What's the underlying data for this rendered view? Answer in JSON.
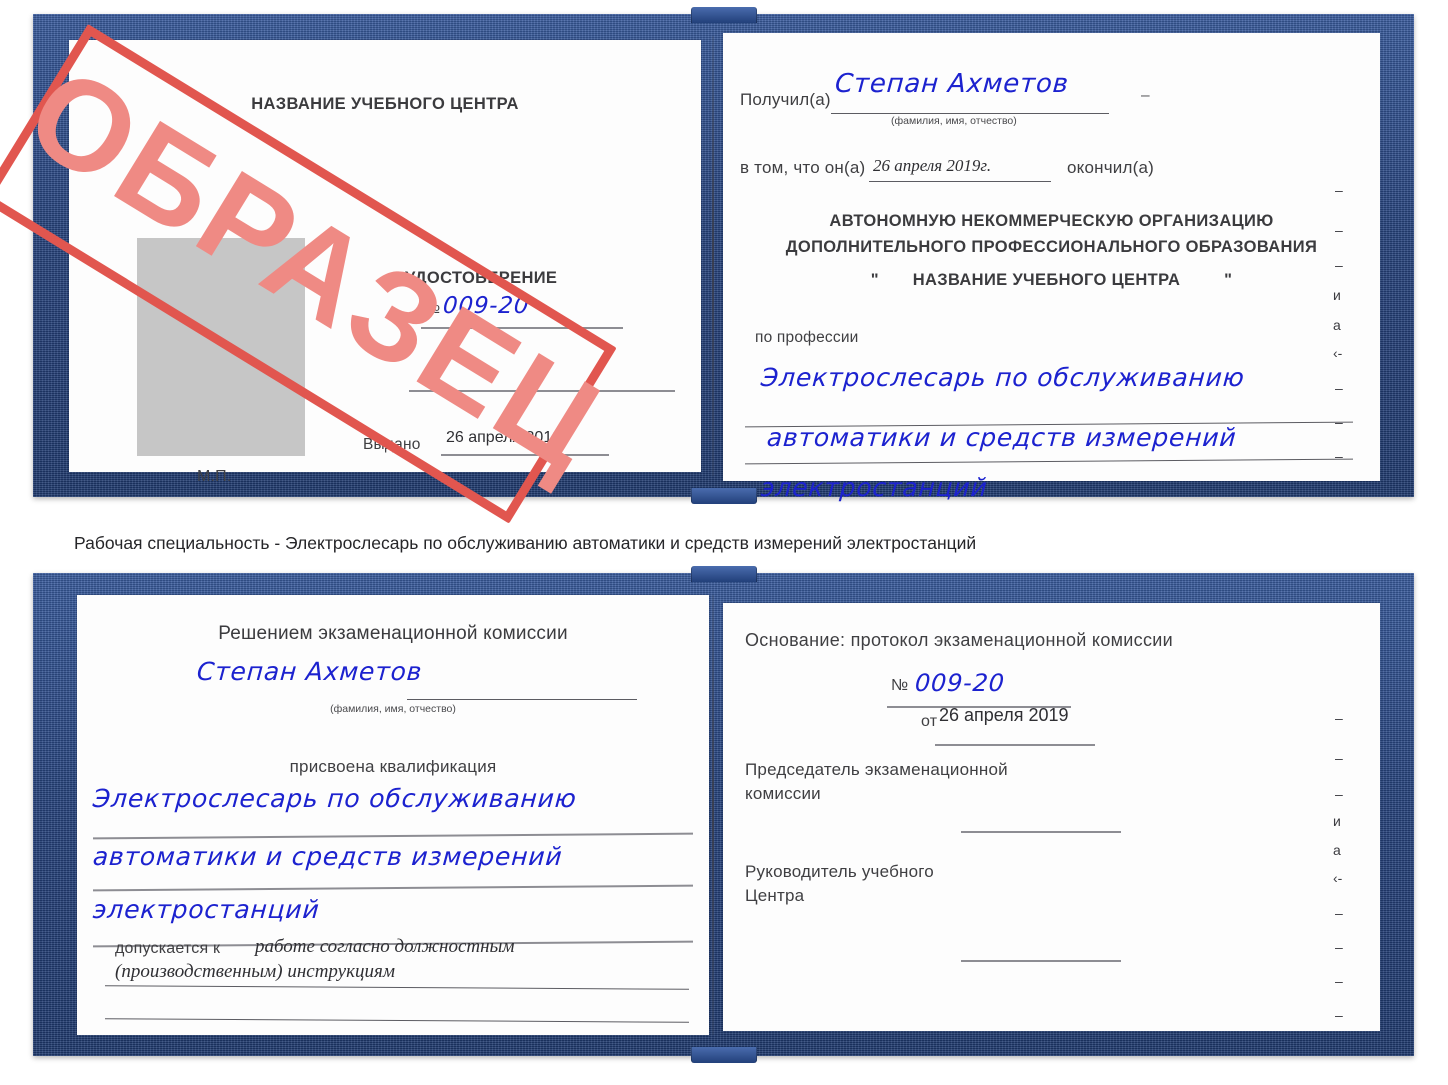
{
  "meta": {
    "watermark": "ОБРАЗЕЦ",
    "accent_blue": "#2b4a8b",
    "handwriting_blue": "#1c22cf",
    "stamp_red": "#e1564f",
    "stamp_red_fill": "#ef8a84",
    "photo_placeholder_gray": "#c6c6c6"
  },
  "caption": "Рабочая специальность - Электрослесарь по обслуживанию автоматики и средств измерений электростанций",
  "doc1": {
    "left_page": {
      "org_title": "НАЗВАНИЕ УЧЕБНОГО ЦЕНТРА",
      "doc_type": "УДОСТОВЕРЕНИЕ",
      "number_label": "№",
      "number_value": "009-20",
      "issued_label": "Выдано",
      "issued_value": "26 апреля 2019",
      "seal_label": "М.П."
    },
    "right_page": {
      "received_label": "Получил(а)",
      "received_value": "Степан Ахметов",
      "fio_hint": "(фамилия, имя, отчество)",
      "that_he_label": "в том, что он(а)",
      "date_value": "26 апреля 2019г.",
      "finished_label": "окончил(а)",
      "org_line1": "АВТОНОМНУЮ НЕКОММЕРЧЕСКУЮ ОРГАНИЗАЦИЮ",
      "org_line2": "ДОПОЛНИТЕЛЬНОГО ПРОФЕССИОНАЛЬНОГО ОБРАЗОВАНИЯ",
      "org_quote_open": "\"",
      "org_line3": "НАЗВАНИЕ УЧЕБНОГО ЦЕНТРА",
      "org_quote_close": "\"",
      "profession_label": "по профессии",
      "profession_line1": "Электрослесарь по обслуживанию",
      "profession_line2": "автоматики и средств измерений",
      "profession_line3": "электростанций",
      "edge_glyphs": [
        "–",
        "–",
        "–",
        "и",
        "а",
        "‹-",
        "–",
        "–",
        "–",
        "–"
      ]
    }
  },
  "doc2": {
    "left_page": {
      "decision_title": "Решением экзаменационной комиссии",
      "name_value": "Степан Ахметов",
      "fio_hint": "(фамилия, имя, отчество)",
      "qualification_label": "присвоена квалификация",
      "qualification_line1": "Электрослесарь по обслуживанию",
      "qualification_line2": "автоматики и средств измерений",
      "qualification_line3": "электростанций",
      "admitted_label": "допускается к",
      "admitted_line1": "работе согласно должностным",
      "admitted_line2": "(производственным) инструкциям"
    },
    "right_page": {
      "basis_label": "Основание: протокол экзаменационной комиссии",
      "number_label": "№",
      "number_value": "009-20",
      "date_label": "от",
      "date_value": "26 апреля 2019",
      "chairman_line1": "Председатель экзаменационной",
      "chairman_line2": "комиссии",
      "head_line1": "Руководитель учебного",
      "head_line2": "Центра",
      "edge_glyphs": [
        "–",
        "–",
        "–",
        "и",
        "а",
        "‹-",
        "–",
        "–",
        "–",
        "–"
      ]
    }
  }
}
